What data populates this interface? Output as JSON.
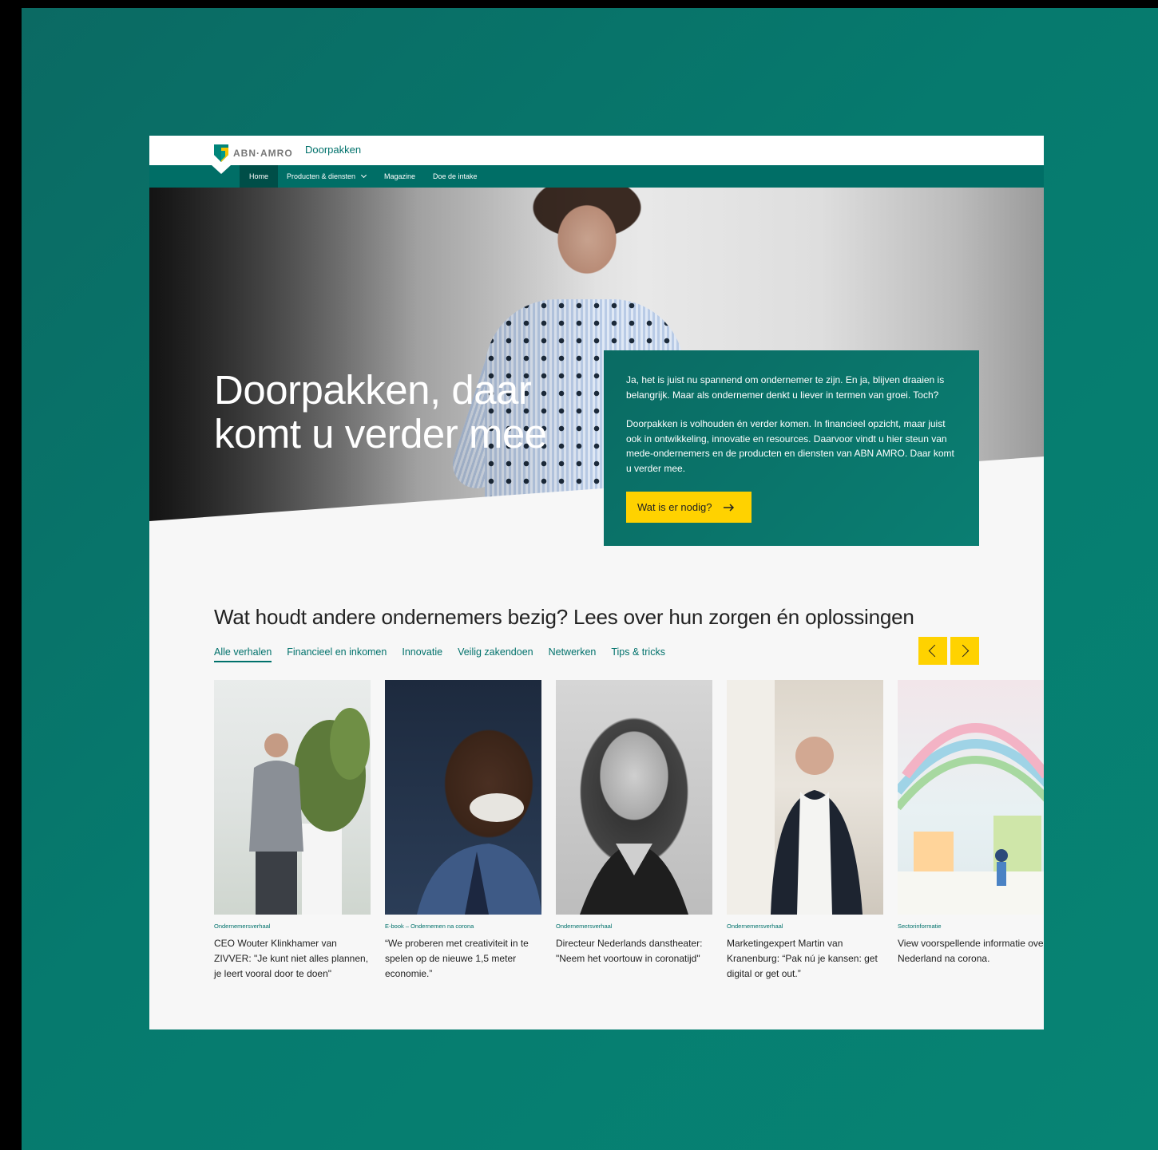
{
  "brand": {
    "logo_text": "ABN·AMRO",
    "site_title": "Doorpakken",
    "primary_color": "#006e66",
    "accent_color": "#ffd200"
  },
  "nav": {
    "items": [
      {
        "label": "Home",
        "active": true
      },
      {
        "label": "Producten & diensten",
        "has_dropdown": true
      },
      {
        "label": "Magazine"
      },
      {
        "label": "Doe de intake"
      }
    ]
  },
  "hero": {
    "title": "Doorpakken, daar komt u verder mee",
    "paragraph1": "Ja, het is juist nu spannend om ondernemer te zijn. En ja, blijven draaien is belangrijk. Maar als ondernemer denkt u liever in termen van groei. Toch?",
    "paragraph2": "Doorpakken is volhouden én verder komen. In financieel opzicht, maar juist ook in ontwikkeling, innovatie en resources. Daarvoor vindt u hier steun van mede-ondernemers en de producten en diensten van ABN AMRO. Daar komt u verder mee.",
    "cta_label": "Wat is er nodig?",
    "cta_icon": "arrow-right-icon"
  },
  "stories": {
    "title": "Wat houdt andere ondernemers bezig? Lees over hun zorgen én oplossingen",
    "tabs": [
      "Alle verhalen",
      "Financieel en inkomen",
      "Innovatie",
      "Veilig zakendoen",
      "Netwerken",
      "Tips & tricks"
    ],
    "active_tab": "Alle verhalen",
    "cards": [
      {
        "meta": "Ondernemersverhaal",
        "title": "CEO Wouter Klinkhamer van ZIVVER: \"Je kunt niet alles plannen, je leert vooral door te doen\""
      },
      {
        "meta": "E-book – Ondernemen na corona",
        "title": "“We proberen met creativiteit in te spelen op de nieuwe 1,5 meter economie.”"
      },
      {
        "meta": "Ondernemersverhaal",
        "title": "Directeur Nederlands danstheater: \"Neem het voortouw in coronatijd\""
      },
      {
        "meta": "Ondernemersverhaal",
        "title": "Marketingexpert Martin van Kranenburg: “Pak nú je kansen: get digital or get out.”"
      },
      {
        "meta": "Sectorinformatie",
        "title": "View voorspellende informatie over Nederland na corona."
      }
    ]
  }
}
